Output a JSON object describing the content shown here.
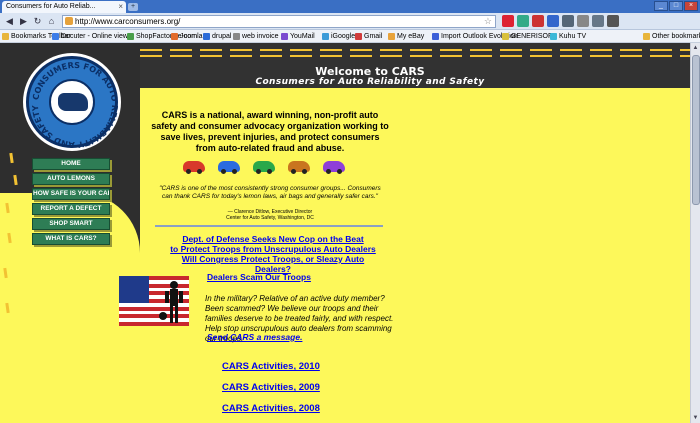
{
  "browser": {
    "tab_title": "Consumers for Auto Reliab...",
    "tab_close": "×",
    "new_tab": "+",
    "window_buttons": [
      "_",
      "□",
      "×"
    ],
    "nav": {
      "back": "◀",
      "forward": "▶",
      "reload": "↻",
      "home": "⌂"
    },
    "url": "http://www.carconsumers.org/",
    "star": "☆",
    "extensions": [
      {
        "name": "ebay-icon",
        "color": "#d23"
      },
      {
        "name": "chart-icon",
        "color": "#3a8"
      },
      {
        "name": "gmail-icon",
        "color": "#c33"
      },
      {
        "name": "calendar-icon",
        "color": "#36c"
      },
      {
        "name": "flag-icon",
        "color": "#567"
      },
      {
        "name": "lock-icon",
        "color": "#888"
      },
      {
        "name": "page-icon",
        "color": "#678"
      },
      {
        "name": "wrench-icon",
        "color": "#555"
      }
    ],
    "bookmarks": [
      {
        "label": "Bookmarks Toolbar",
        "color": "#e8b53b"
      },
      {
        "label": "Docuter - Online viewer",
        "color": "#3b7ce8"
      },
      {
        "label": "ShopFactory e-com",
        "color": "#4a9e4a"
      },
      {
        "label": "Joomla",
        "color": "#e26b2b"
      },
      {
        "label": "drupal",
        "color": "#2b6bd8"
      },
      {
        "label": "web invoice",
        "color": "#888"
      },
      {
        "label": "YouMail",
        "color": "#7a4ad0"
      },
      {
        "label": "iGoogle",
        "color": "#3b9bd8"
      },
      {
        "label": "Gmail",
        "color": "#d03b3b"
      },
      {
        "label": "My eBay",
        "color": "#e8a33b"
      },
      {
        "label": "Import Outlook Evolution",
        "color": "#3b5fd8"
      },
      {
        "label": "GENERISOFT",
        "color": "#d8c13b"
      },
      {
        "label": "Kuhu TV",
        "color": "#3bb8d8"
      },
      {
        "label": "Other bookmarks",
        "color": "#e8b53b"
      }
    ]
  },
  "header": {
    "welcome": "Welcome to CARS",
    "tagline": "Consumers for Auto Reliability and Safety",
    "seal_text": "CONSUMERS FOR AUTO RELIABILITY AND SAFETY"
  },
  "menu": [
    "HOME",
    "AUTO LEMONS",
    "HOW SAFE IS YOUR CAR?",
    "REPORT A DEFECT",
    "SHOP SMART",
    "WHAT IS CARS?"
  ],
  "intro": "CARS is a national, award winning, non-profit auto safety and consumer advocacy organization working to save lives, prevent injuries, and protect consumers from auto-related fraud and abuse.",
  "car_colors": [
    "#d8392b",
    "#2b6be0",
    "#2aa84a",
    "#c9751f",
    "#8f3fd8"
  ],
  "quote": "\"CARS is one of the most consistently strong consumer groups... Consumers can thank CARS for today's lemon laws, air bags and generally safer cars.\"",
  "attribution": {
    "name": "— Clarence Ditlow, Executive Director",
    "org": "Center for Auto Safety, Washington, DC"
  },
  "headline": [
    "Dept. of Defense Seeks New Cop on the Beat",
    "to Protect Troops from Unscrupulous Auto Dealers",
    "Will Congress Protect Troops, or Sleazy Auto Dealers?"
  ],
  "dealers": {
    "title": "Dealers Scam Our Troops",
    "body": "In the military? Relative of an active duty member? Been scammed? We believe our troops and their families deserve to be treated fairly, and with respect. Help stop unscrupulous auto dealers from scamming our troops.",
    "send": "Send CARS a message."
  },
  "activities": [
    "CARS Activities, 2010",
    "CARS Activities, 2009",
    "CARS Activities, 2008"
  ]
}
